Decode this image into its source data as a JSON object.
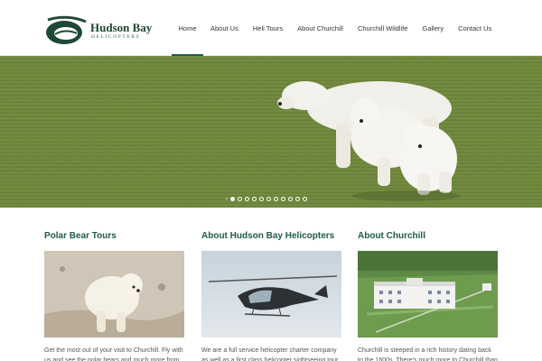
{
  "brand": {
    "name": "Hudson Bay",
    "tagline": "HELICOPTERS",
    "primary_color": "#1f5c42"
  },
  "nav": {
    "items": [
      {
        "label": "Home",
        "active": true
      },
      {
        "label": "About Us",
        "active": false
      },
      {
        "label": "Heli Tours",
        "active": false
      },
      {
        "label": "About Churchill",
        "active": false
      },
      {
        "label": "Churchill Wildlife",
        "active": false
      },
      {
        "label": "Gallery",
        "active": false
      },
      {
        "label": "Contact Us",
        "active": false
      }
    ]
  },
  "hero": {
    "slide_count": 11,
    "active_slide": 0,
    "prev_arrow": "‹"
  },
  "columns": [
    {
      "title": "Polar Bear Tours",
      "text": "Get the most out of your visit to Churchill. Fly with us and see the polar bears and much more from"
    },
    {
      "title": "About Hudson Bay Helicopters",
      "text": "We are a full service helicopter charter company as well as a first class helicopter sightseeing tour"
    },
    {
      "title": "About Churchill",
      "text": "Churchill is steeped in a rich history dating back to the 1600s. There's much more to Churchill than"
    }
  ]
}
